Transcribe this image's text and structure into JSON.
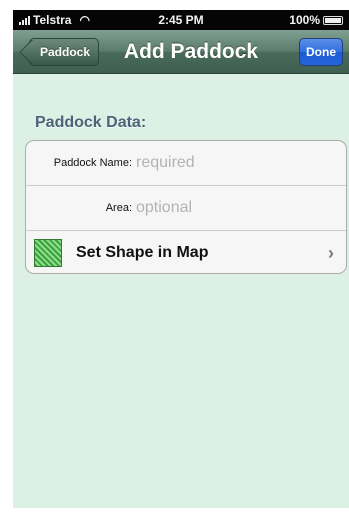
{
  "status_bar": {
    "carrier": "Telstra",
    "time": "2:45 PM",
    "battery": "100%"
  },
  "nav_bar": {
    "back_label": "Paddock",
    "title": "Add Paddock",
    "done_label": "Done"
  },
  "section": {
    "header": "Paddock Data:"
  },
  "fields": {
    "name": {
      "label": "Paddock Name:",
      "placeholder": "required",
      "value": ""
    },
    "area": {
      "label": "Area:",
      "placeholder": "optional",
      "value": ""
    }
  },
  "shape_row": {
    "label": "Set Shape in Map",
    "icon": "polygon-shape-icon",
    "accessory": "›"
  },
  "colors": {
    "background": "#ddf0e6",
    "nav_bar": "#4a6b5b",
    "done_button": "#2464d9",
    "section_header": "#4d6478"
  }
}
